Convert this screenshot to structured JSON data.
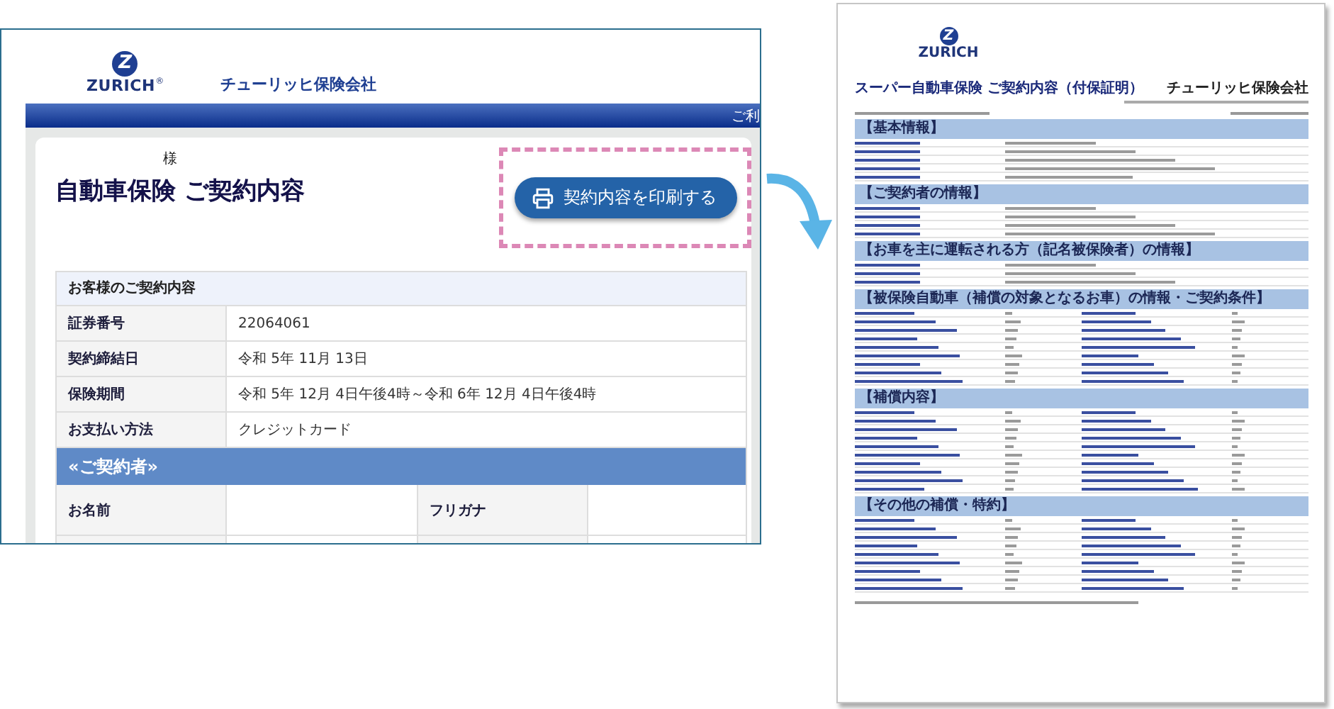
{
  "screenshot": {
    "logo": {
      "letter": "Z",
      "wordmark": "ZURICH",
      "registered": "®"
    },
    "company": "チューリッヒ保険会社",
    "nav_bar": {
      "text": "ご利"
    },
    "honorific": "様",
    "title": "自動車保険 ご契約内容",
    "print_button": {
      "label": "契約内容を印刷する",
      "highlighted": true
    },
    "contract_table": {
      "heading": "お客様のご契約内容",
      "rows": [
        {
          "label": "証券番号",
          "value": "22064061"
        },
        {
          "label": "契約締結日",
          "value": "令和 5年 11月 13日"
        },
        {
          "label": "保険期間",
          "value": "令和 5年 12月 4日午後4時～令和 6年 12月 4日午後4時"
        },
        {
          "label": "お支払い方法",
          "value": "クレジットカード"
        }
      ]
    },
    "contractor_section": {
      "heading": "«ご契約者»",
      "fields": [
        {
          "label": "お名前"
        },
        {
          "label": "フリガナ"
        }
      ]
    }
  },
  "document": {
    "logo": {
      "letter": "Z",
      "wordmark": "ZURICH"
    },
    "title": "スーパー自動車保険 ご契約内容（付保証明）",
    "company": "チューリッヒ保険会社",
    "sections": [
      {
        "title": "【基本情報】",
        "kind": "two_column"
      },
      {
        "title": "【ご契約者の情報】",
        "kind": "two_column"
      },
      {
        "title": "【お車を主に運転される方（記名被保険者）の情報】",
        "kind": "two_column"
      },
      {
        "title": "【被保険自動車（補償の対象となるお車）の情報・ご契約条件】",
        "kind": "four_column"
      },
      {
        "title": "【補償内容】",
        "kind": "four_column"
      },
      {
        "title": "【その他の補償・特約】",
        "kind": "four_column"
      }
    ]
  }
}
